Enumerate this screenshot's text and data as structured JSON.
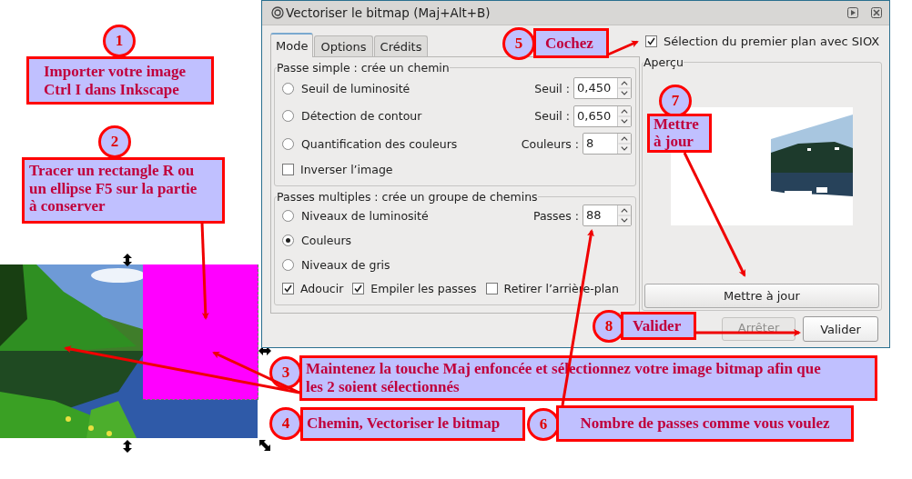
{
  "dialog": {
    "title": "Vectoriser le bitmap (Maj+Alt+B)",
    "tabs": [
      {
        "label": "Mode",
        "selected": true
      },
      {
        "label": "Options",
        "selected": false
      },
      {
        "label": "Crédits",
        "selected": false
      }
    ],
    "groups": [
      {
        "title": "Passe simple : crée un chemin",
        "options": [
          {
            "label": "Seuil de luminosité",
            "selected": false,
            "field_label": "Seuil :",
            "value": "0,450"
          },
          {
            "label": "Détection de contour",
            "selected": false,
            "field_label": "Seuil :",
            "value": "0,650"
          },
          {
            "label": "Quantification des couleurs",
            "selected": false,
            "field_label": "Couleurs :",
            "value": "8"
          }
        ],
        "checks": [
          {
            "label": "Inverser l’image",
            "checked": false
          }
        ]
      },
      {
        "title": "Passes multiples : crée un groupe de chemins",
        "options": [
          {
            "label": "Niveaux de luminosité",
            "selected": false,
            "field_label": "Passes :",
            "value": "88"
          },
          {
            "label": "Couleurs",
            "selected": true
          },
          {
            "label": "Niveaux de gris",
            "selected": false
          }
        ],
        "checks": [
          {
            "label": "Adoucir",
            "checked": true
          },
          {
            "label": "Empiler les passes",
            "checked": true
          },
          {
            "label": "Retirer l’arrière-plan",
            "checked": false
          }
        ]
      }
    ],
    "siox": {
      "label": "Sélection du premier plan avec SIOX",
      "checked": true
    },
    "preview": {
      "title": "Aperçu"
    },
    "update_button": "Mettre à jour",
    "buttons": [
      {
        "label": "Arrêter",
        "disabled": true
      },
      {
        "label": "Valider",
        "disabled": false
      }
    ]
  },
  "annotations": [
    {
      "number": "1",
      "text": "Importer votre image\nCtrl I dans Inkscape"
    },
    {
      "number": "2",
      "text": "Tracer un rectangle R ou\nun ellipse F5 sur la partie\nà conserver"
    },
    {
      "number": "3",
      "text": "Maintenez la touche Maj enfoncée et sélectionnez votre image bitmap afin que\nles 2 soient sélectionnés"
    },
    {
      "number": "4",
      "text": "Chemin, Vectoriser le bitmap"
    },
    {
      "number": "5",
      "text": "Cochez"
    },
    {
      "number": "6",
      "text": "Nombre de passes comme vous voulez"
    },
    {
      "number": "7",
      "text": "Mettre\nà jour"
    },
    {
      "number": "8",
      "text": "Valider"
    }
  ]
}
